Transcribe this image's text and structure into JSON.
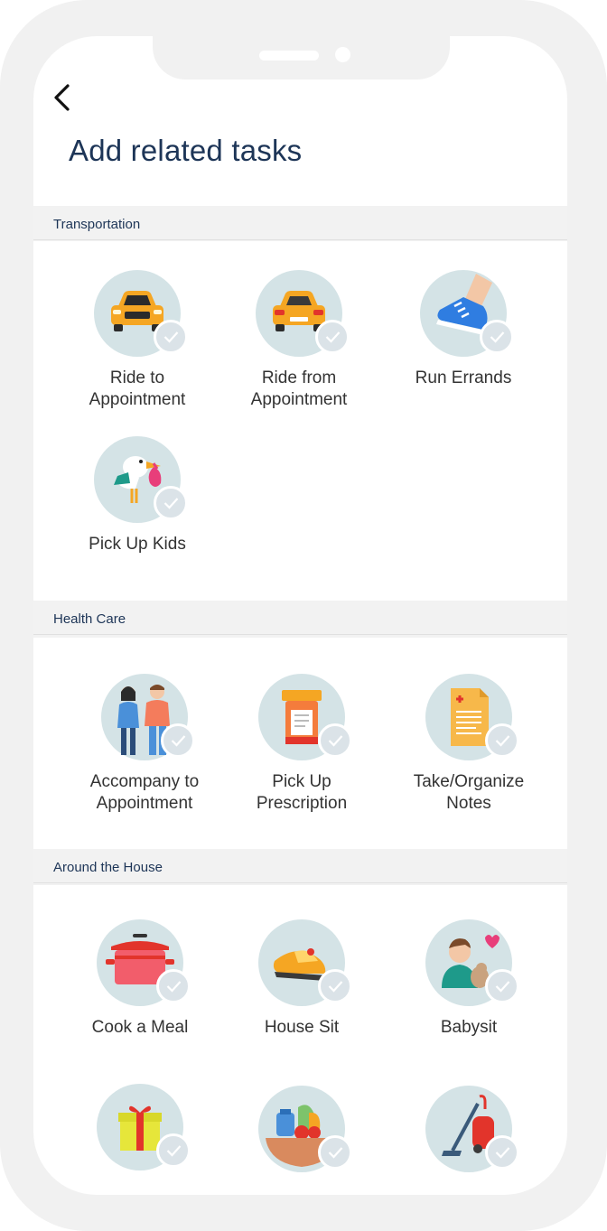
{
  "page": {
    "title": "Add related tasks"
  },
  "sections": [
    {
      "title": "Transportation",
      "tasks": [
        {
          "label": "Ride to\nAppointment",
          "icon": "car-front-icon"
        },
        {
          "label": "Ride from\nAppointment",
          "icon": "car-rear-icon"
        },
        {
          "label": "Run Errands",
          "icon": "running-shoe-icon"
        },
        {
          "label": "Pick Up Kids",
          "icon": "stork-icon"
        }
      ]
    },
    {
      "title": "Health Care",
      "tasks": [
        {
          "label": "Accompany to\nAppointment",
          "icon": "couple-icon"
        },
        {
          "label": "Pick Up\nPrescription",
          "icon": "pill-bottle-icon"
        },
        {
          "label": "Take/Organize\nNotes",
          "icon": "medical-notes-icon"
        }
      ]
    },
    {
      "title": "Around the House",
      "tasks": [
        {
          "label": "Cook a Meal",
          "icon": "cooking-pot-icon"
        },
        {
          "label": "House Sit",
          "icon": "slipper-icon"
        },
        {
          "label": "Babysit",
          "icon": "child-with-heart-icon"
        },
        {
          "label": "",
          "icon": "gift-icon"
        },
        {
          "label": "",
          "icon": "grocery-basket-icon"
        },
        {
          "label": "",
          "icon": "vacuum-cleaner-icon"
        }
      ]
    }
  ],
  "colors": {
    "title": "#1d3557",
    "circle_bg": "#d4e3e6",
    "check_bg": "#dbe3e8"
  }
}
